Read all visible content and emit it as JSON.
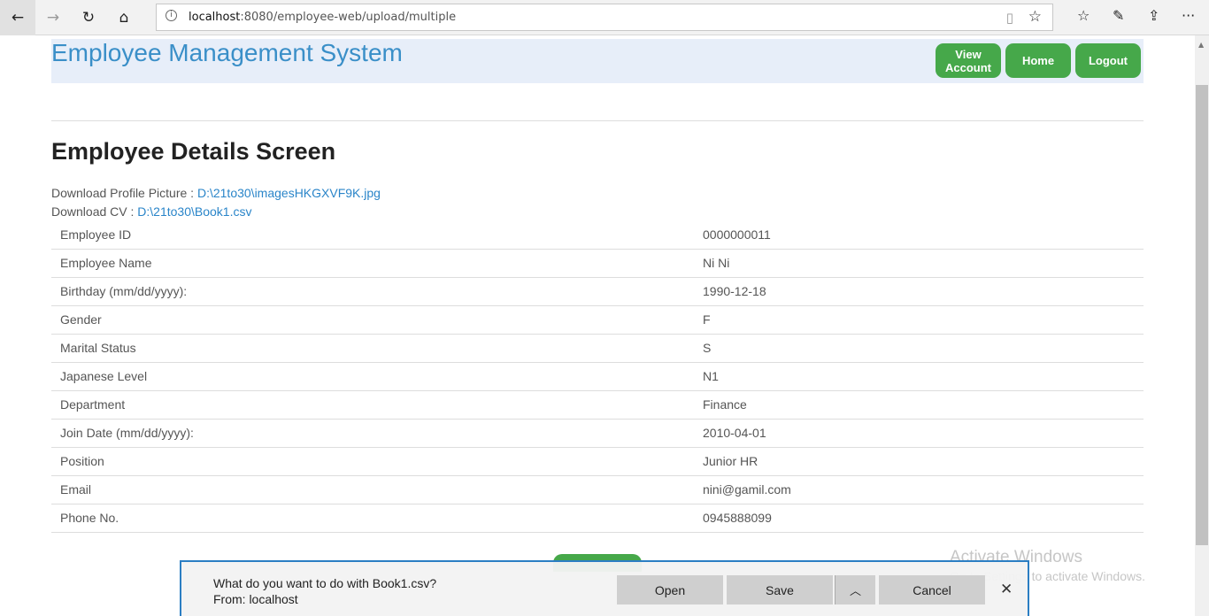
{
  "browser": {
    "back_icon": "←",
    "forward_icon": "→",
    "refresh_icon": "↻",
    "home_icon": "⌂",
    "info_icon": "i",
    "url_host": "localhost",
    "url_path": ":8080/employee-web/upload/multiple",
    "reading_view_icon": "▯",
    "favorite_icon": "☆",
    "favorites_hub_icon": "☆",
    "notes_icon": "✎",
    "share_icon": "⇪",
    "more_icon": "···"
  },
  "header": {
    "title": "Employee Management System",
    "view_account_label": "View Account",
    "home_label": "Home",
    "logout_label": "Logout"
  },
  "page": {
    "heading": "Employee Details Screen",
    "profile_label": "Download Profile Picture : ",
    "profile_link": "D:\\21to30\\imagesHKGXVF9K.jpg",
    "cv_label": "Download CV : ",
    "cv_link": "D:\\21to30\\Book1.csv"
  },
  "details": [
    {
      "label": "Employee ID",
      "value": "0000000011"
    },
    {
      "label": "Employee Name",
      "value": "Ni Ni"
    },
    {
      "label": "Birthday (mm/dd/yyyy):",
      "value": "1990-12-18"
    },
    {
      "label": "Gender",
      "value": "F"
    },
    {
      "label": "Marital Status",
      "value": "S"
    },
    {
      "label": "Japanese Level",
      "value": "N1"
    },
    {
      "label": "Department",
      "value": "Finance"
    },
    {
      "label": "Join Date (mm/dd/yyyy):",
      "value": "2010-04-01"
    },
    {
      "label": "Position",
      "value": "Junior HR"
    },
    {
      "label": "Email",
      "value": "nini@gamil.com"
    },
    {
      "label": "Phone No.",
      "value": "0945888099"
    }
  ],
  "watermark": {
    "title": "Activate Windows",
    "subtitle": "Go to Settings to activate Windows."
  },
  "download_bar": {
    "question": "What do you want to do with Book1.csv?",
    "from": "From: localhost",
    "open_label": "Open",
    "save_label": "Save",
    "more_icon": "︿",
    "cancel_label": "Cancel",
    "close_icon": "✕"
  },
  "colors": {
    "accent_green": "#46a84a",
    "title_blue": "#3a8fc8",
    "link_blue": "#2a85c9",
    "header_bg": "#e7eef9",
    "download_bar_border": "#2b7ec3"
  }
}
